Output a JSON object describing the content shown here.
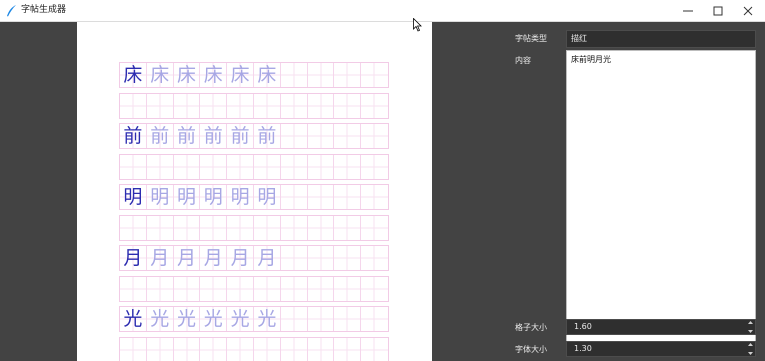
{
  "window": {
    "title": "字帖生成器"
  },
  "worksheet": {
    "rows": [
      {
        "char": "床",
        "count": 6
      },
      {
        "char": "",
        "count": 0
      },
      {
        "char": "前",
        "count": 6
      },
      {
        "char": "",
        "count": 0
      },
      {
        "char": "明",
        "count": 6
      },
      {
        "char": "",
        "count": 0
      },
      {
        "char": "月",
        "count": 6
      },
      {
        "char": "",
        "count": 0
      },
      {
        "char": "光",
        "count": 6
      },
      {
        "char": "",
        "count": 0
      }
    ],
    "columns": 10
  },
  "settings": {
    "type_label": "字帖类型",
    "type_value": "描红",
    "content_label": "内容",
    "content_value": "床前明月光",
    "grid_size_label": "格子大小",
    "grid_size_value": "1.60",
    "font_size_label": "字体大小",
    "font_size_value": "1.30"
  },
  "colors": {
    "main_char": "#2c2cb0",
    "trace_char": "#a7a7e4",
    "grid_line": "#f2cbe6",
    "background": "#434343"
  }
}
